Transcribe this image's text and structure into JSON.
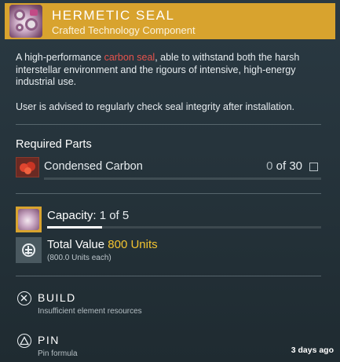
{
  "header": {
    "title": "HERMETIC SEAL",
    "subtitle": "Crafted Technology Component",
    "icon": "hermetic-seal-icon",
    "color": "#d8a32e"
  },
  "description": {
    "before": "A high-performance ",
    "highlight": "carbon seal",
    "after": ", able to withstand both the harsh interstellar environment and the rigours of intensive, high-energy industrial use.",
    "highlight_color": "#e5534d"
  },
  "advice": "User is advised to regularly check seal integrity after installation.",
  "required_parts": {
    "title": "Required Parts",
    "items": [
      {
        "name": "Condensed Carbon",
        "have": "0",
        "of_label": "of",
        "need": "30",
        "icon": "condensed-carbon-icon"
      }
    ]
  },
  "capacity": {
    "label": "Capacity:",
    "current": "1",
    "of_label": "of",
    "max": "5",
    "fill_fraction": 0.2
  },
  "value": {
    "label": "Total Value",
    "amount": "800 Units",
    "sub": "(800.0 Units each)",
    "amount_color": "#f2c330"
  },
  "actions": [
    {
      "label": "BUILD",
      "sub": "Insufficient element resources",
      "icon": "cross-button-icon"
    },
    {
      "label": "PIN",
      "sub": "Pin formula",
      "icon": "triangle-button-icon"
    }
  ],
  "timestamp": "3 days ago"
}
